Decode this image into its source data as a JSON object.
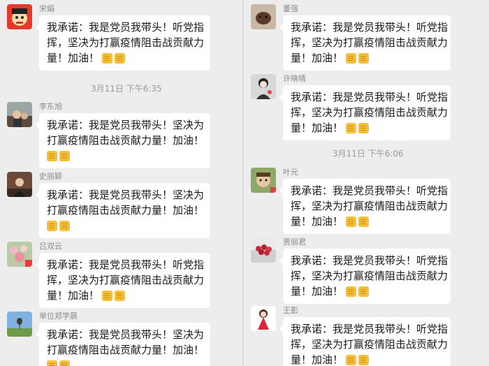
{
  "left": {
    "messages": [
      {
        "sender": "宋娟",
        "lines": [
          "我承诺：我是党员我带头！听党指",
          "挥，坚决为打赢疫情阻击战贡献力",
          "量！加油！"
        ],
        "emoji": "fist-emoji"
      },
      {
        "sender": "李东旭",
        "lines": [
          "我承诺：我是党员我带头！坚决为",
          "打赢疫情阻击战贡献力量！加油！",
          ""
        ],
        "emoji": "fist-emoji"
      },
      {
        "sender": "史丽颖",
        "lines": [
          "我承诺：我是党员我带头！坚决为",
          "打赢疫情阻击战贡献力量！加油！",
          ""
        ],
        "emoji": "fist-emoji"
      },
      {
        "sender": "吕双云",
        "lines": [
          "我承诺：我是党员我带头！听党指",
          "挥，坚决为打赢疫情阻击战贡献力",
          "量！加油！"
        ],
        "emoji": "fist-emoji"
      },
      {
        "sender": "单位郑学晨",
        "lines": [
          "我承诺：我是党员我带头！坚决为",
          "打赢疫情阻击战贡献力量！加油！",
          ""
        ],
        "emoji": "fist-emoji"
      }
    ],
    "timestamp": "3月11日 下午6:35"
  },
  "right": {
    "messages": [
      {
        "sender": "董强",
        "lines": [
          "我承诺：我是党员我带头！听党指",
          "挥，坚决为打赢疫情阻击战贡献力",
          "量！加油！"
        ],
        "emoji": "fist-emoji"
      },
      {
        "sender": "许晓晴",
        "lines": [
          "我承诺：我是党员我带头！听党指",
          "挥，坚决为打赢疫情阻击战贡献力",
          "量！加油！"
        ],
        "emoji": "fist-emoji"
      },
      {
        "sender": "叶元",
        "lines": [
          "我承诺：我是党员我带头！听党指",
          "挥，坚决为打赢疫情阻击战贡献力",
          "量！加油！"
        ],
        "emoji": "fist-emoji"
      },
      {
        "sender": "贾丽君",
        "lines": [
          "我承诺：我是党员我带头！听党指",
          "挥，坚决为打赢疫情阻击战贡献力",
          "量！加油！"
        ],
        "emoji": "fist-emoji"
      },
      {
        "sender": "王影",
        "lines": [
          "我承诺：我是党员我带头！听党指",
          "挥，坚决为打赢疫情阻击战贡献力",
          "量！加油！"
        ],
        "emoji": "fist-emoji"
      }
    ],
    "timestamp": "3月11日 下午6:06"
  },
  "colors": {
    "background": "#ededed",
    "bubble": "#ffffff",
    "sender_text": "#8a8a8a",
    "timestamp_text": "#9a9a9a",
    "emoji": "#f5c037"
  }
}
